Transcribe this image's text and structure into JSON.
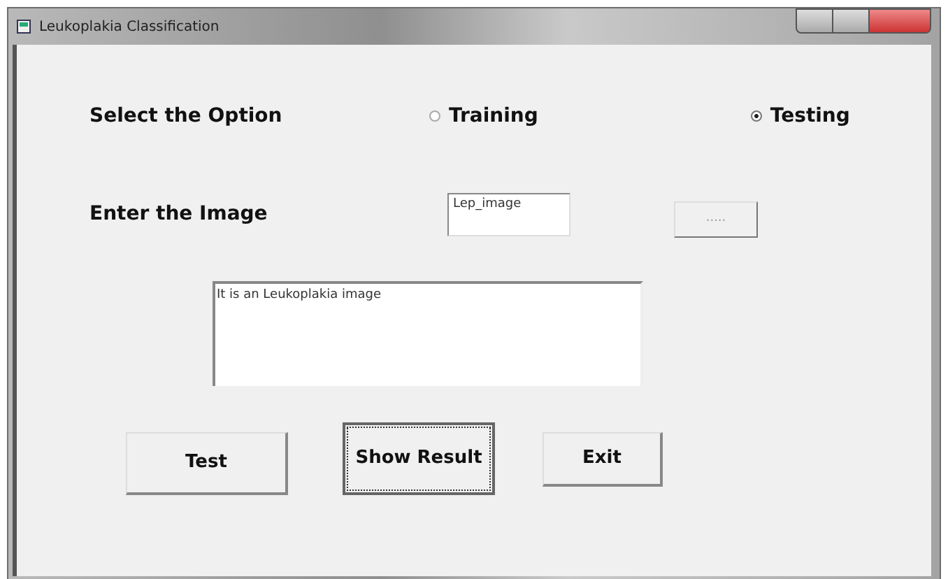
{
  "window": {
    "title": "Leukoplakia Classification"
  },
  "option_label": "Select the Option",
  "options": [
    {
      "label": "Training",
      "selected": false
    },
    {
      "label": "Testing",
      "selected": true
    }
  ],
  "image_label": "Enter the Image",
  "image_field": {
    "value": "Lep_image"
  },
  "browse_button": {
    "label": ".....",
    "disabled": true
  },
  "result_box": {
    "value": "It is an Leukoplakia image"
  },
  "buttons": [
    {
      "label": "Test",
      "focused": false
    },
    {
      "label": "Show Result",
      "focused": true
    },
    {
      "label": "Exit",
      "focused": false
    }
  ]
}
